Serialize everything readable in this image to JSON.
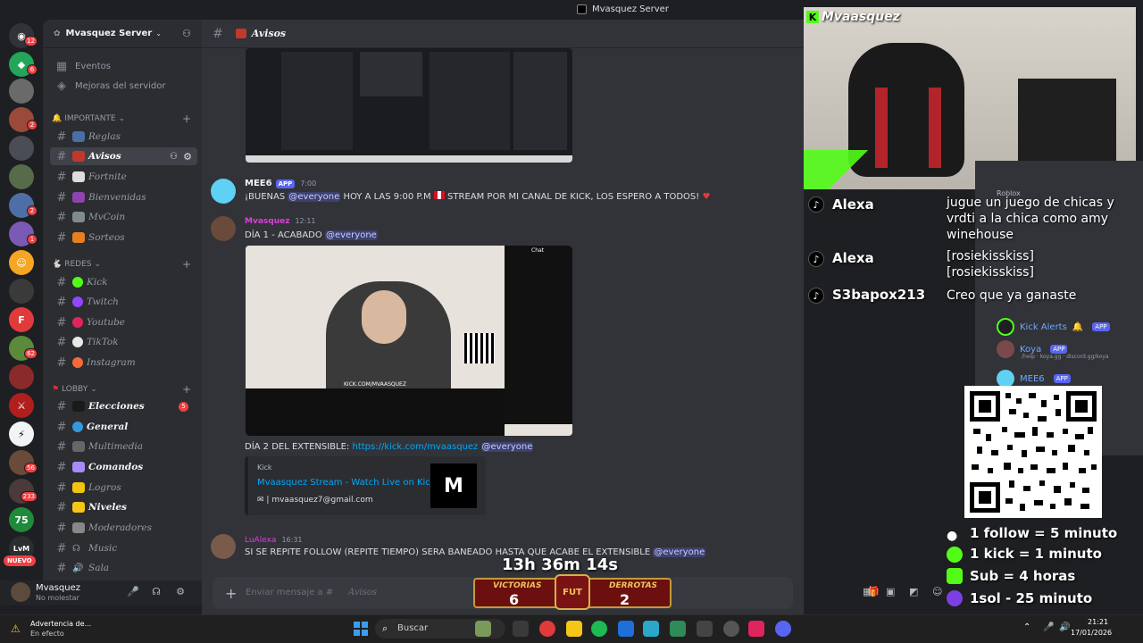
{
  "window": {
    "title": "Mvasquez Server"
  },
  "server_rail": {
    "badges": [
      "12",
      "6",
      "2",
      "1",
      "2",
      "2",
      "1",
      "1",
      "1",
      "6",
      "62",
      "1",
      "5",
      "56",
      "233",
      "1"
    ],
    "new_label": "NUEVO",
    "bottom_label": "LvM"
  },
  "sidebar": {
    "server_name": "Mvasquez Server",
    "top_items": [
      "Eventos",
      "Mejoras del servidor"
    ],
    "categories": [
      {
        "label": "IMPORTANTE",
        "channels": [
          "Reglas",
          "Avisos",
          "Fortnite",
          "Bienvenidas",
          "MvCoin",
          "Sorteos"
        ]
      },
      {
        "label": "REDES",
        "channels": [
          "Kick",
          "Twitch",
          "Youtube",
          "TikTok",
          "Instagram"
        ]
      },
      {
        "label": "LOBBY",
        "channels": [
          "Elecciones",
          "General",
          "Multimedia",
          "Comandos",
          "Logros",
          "Niveles",
          "Moderadores",
          "Music",
          "Sala"
        ]
      }
    ],
    "unread_elecciones": "5"
  },
  "user": {
    "name": "Mvasquez",
    "status": "No molestar"
  },
  "chat": {
    "channel": "Avisos",
    "messages": [
      {
        "author": "MEE6",
        "tag": "APP",
        "time": "7:00",
        "text": "¡BUENAS",
        "mention": "@everyone",
        "text2": "HOY A LAS 9:00 P.M",
        "text3": "STREAM POR MI CANAL DE KICK, LOS ESPERO A TODOS!"
      },
      {
        "author": "Mvasquez",
        "time": "12:11",
        "text": "DÍA 1 - ACABADO",
        "mention": "@everyone"
      },
      {
        "text": "DÍA 2 DEL EXTENSIBLE:",
        "link": "https://kick.com/mvaasquez",
        "mention": "@everyone"
      },
      {
        "author": "LuAlexa",
        "time": "16:31",
        "text": "SI SE REPITE FOLLOW (REPITE TIEMPO) SERA BANEADO HASTA QUE ACABE EL EXTENSIBLE",
        "mention": "@everyone"
      }
    ],
    "embed": {
      "provider": "Kick",
      "title": "Mvaasquez Stream - Watch Live on Kick",
      "desc": "| mvaasquez7@gmail.com",
      "thumb": "M"
    },
    "shot_mini": {
      "header": "Chat",
      "url": "KICK.COM/MVAASQUEZ"
    },
    "composer_placeholder": "Enviar mensaje a #",
    "composer_channel": "Avisos"
  },
  "overlay": {
    "cam_name": "Mvaasquez",
    "tiktok": [
      {
        "name": "Alexa",
        "msg": "jugue un juego de chicas y vrdti a la chica como amy winehouse"
      },
      {
        "name": "Alexa",
        "msg": "[rosiekisskiss] [rosiekisskiss]"
      },
      {
        "name": "S3bapox213",
        "msg": "Creo que ya ganaste"
      }
    ],
    "roblox_label": "Roblox",
    "members": [
      {
        "name": "Kick Alerts",
        "tag": "APP"
      },
      {
        "name": "Koya",
        "tag": "APP",
        "sub": "/help · koya.gg · discord.gg/koya"
      },
      {
        "name": "MEE6",
        "tag": "APP"
      }
    ],
    "rules": [
      "1 follow = 5 minuto",
      "1 kick = 1 minuto",
      "Sub = 4 horas",
      "1sol - 25 minuto"
    ],
    "timer": "13h 36m 14s",
    "score": {
      "wins_label": "VICTORIAS",
      "wins": "6",
      "losses_label": "DERROTAS",
      "losses": "2",
      "logo": "FUT"
    }
  },
  "taskbar": {
    "weather_title": "Advertencia de...",
    "weather_sub": "En efecto",
    "search": "Buscar",
    "time": "21:21",
    "date": "17/01/2026"
  }
}
